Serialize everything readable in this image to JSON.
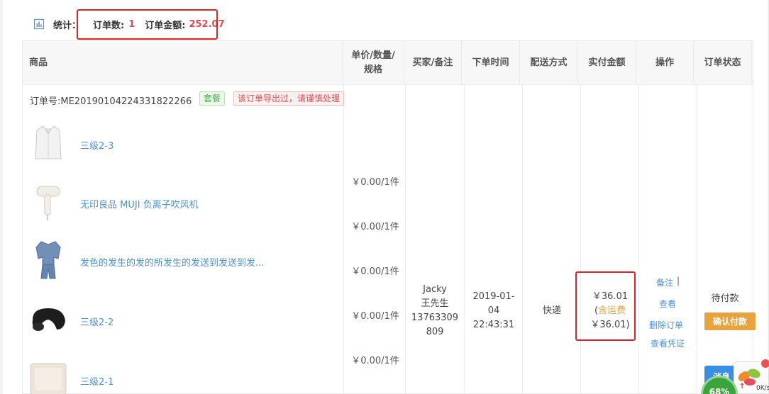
{
  "stats": {
    "prefix": "统计：",
    "order_count_label": "订单数:",
    "order_count": "1",
    "order_amount_label": "订单金额:",
    "order_amount": "252.07"
  },
  "table": {
    "headers": {
      "goods": "商品",
      "unit_price_line1": "单价/数量/",
      "unit_price_line2": "规格",
      "buyer": "买家/备注",
      "order_time": "下单时间",
      "delivery": "配送方式",
      "paid": "实付金额",
      "ops": "操作",
      "status": "订单状态"
    },
    "order": {
      "order_no": "订单号:ME20190104224331822266",
      "tag_package": "套餐",
      "tag_warning": "该订单导出过，请谨慎处理",
      "products": [
        {
          "name": "三级2-3",
          "icon": "shirt-image"
        },
        {
          "name": "无印良品 MUJI 负离子吹风机",
          "icon": "hairdryer-image"
        },
        {
          "name": "发色的发生的发的所发生的发送到发送到发...",
          "icon": "pajamas-image"
        },
        {
          "name": "三级2-2",
          "icon": "neck-pillow-image"
        },
        {
          "name": "三级2-1",
          "icon": "pillow-image"
        }
      ],
      "prices": [
        "￥0.00/1件",
        "￥0.00/1件",
        "￥0.00/1件",
        "￥0.00/1件",
        "￥0.00/1件"
      ],
      "buyer": {
        "name": "Jacky",
        "receiver": "王先生",
        "phone_line1": "13763309",
        "phone_line2": "809"
      },
      "time": {
        "line1": "2019-01-",
        "line2": "04",
        "line3": "22:43:31"
      },
      "delivery": "快递",
      "paid": {
        "amount": "￥36.01",
        "shipping_prefix": "(",
        "shipping_label": "含运费",
        "shipping_amount": "￥36.01)"
      },
      "ops": {
        "remark": "备注",
        "divider": "|",
        "view": "查看",
        "delete": "删除订单",
        "view_voucher": "查看凭证"
      },
      "status": "待付款",
      "confirm_button": "确认付款"
    }
  },
  "floating": {
    "consult_button": "消息",
    "gauge_percent": "68%",
    "net_speed": "0K/s",
    "upload_arrow": "↑"
  },
  "colors": {
    "red_highlight": "#e3211f",
    "link_blue": "#4a90d9",
    "orange_button": "#e8a33d",
    "stat_red": "#e5484d"
  }
}
